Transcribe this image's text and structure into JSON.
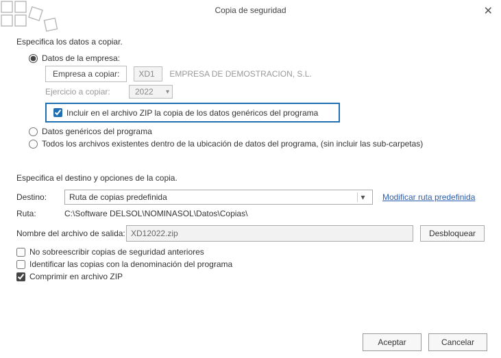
{
  "window": {
    "title": "Copia de seguridad"
  },
  "section1": {
    "header": "Especifica los datos a copiar.",
    "opt_empresa": "Datos de la empresa:",
    "empresa_btn": "Empresa a copiar:",
    "empresa_code": "XD1",
    "empresa_name": "EMPRESA DE DEMOSTRACION, S.L.",
    "ejercicio_label": "Ejercicio a copiar:",
    "ejercicio_value": "2022",
    "incluir_generic": "Incluir en el archivo ZIP la copia de los datos genéricos del programa",
    "opt_genericos": "Datos genéricos del programa",
    "opt_todos": "Todos los archivos existentes dentro de la ubicación de datos del programa, (sin incluir las sub-carpetas)"
  },
  "section2": {
    "header": "Especifica el destino y opciones de la copia.",
    "destino_label": "Destino:",
    "destino_value": "Ruta de copias predefinida",
    "modificar_link": "Modificar ruta predefinida",
    "ruta_label": "Ruta:",
    "ruta_value": "C:\\Software DELSOL\\NOMINASOL\\Datos\\Copias\\",
    "nombre_label": "Nombre del archivo de salida:",
    "nombre_value": "XD12022.zip",
    "desbloquear": "Desbloquear",
    "chk_no_sobre": "No sobreescribir copias de seguridad anteriores",
    "chk_identificar": "Identificar las copias con la denominación del programa",
    "chk_comprimir": "Comprimir en archivo ZIP"
  },
  "footer": {
    "accept": "Aceptar",
    "cancel": "Cancelar"
  }
}
